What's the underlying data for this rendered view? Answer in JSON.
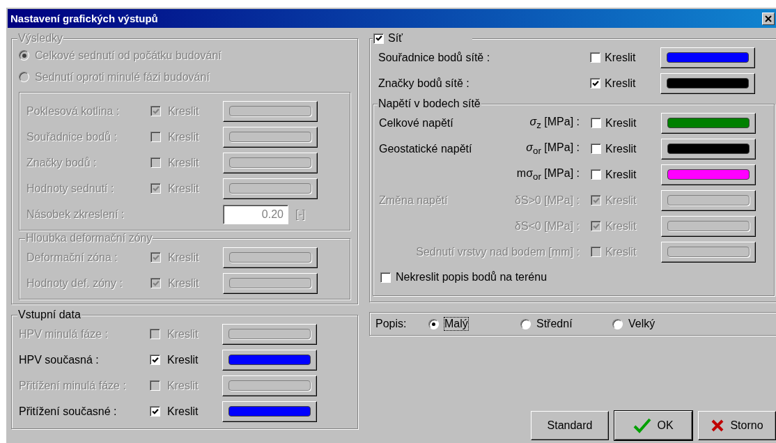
{
  "window": {
    "title": "Nastavení grafických výstupů"
  },
  "results": {
    "title": "Výsledky",
    "disabled": true,
    "radios": [
      {
        "label": "Celkové sednutí od počátku budování",
        "selected": true
      },
      {
        "label": "Sednutí oproti minulé fázi budování",
        "selected": false
      }
    ],
    "rows": [
      {
        "label": "Poklesová kotlina :",
        "checked": true,
        "draw": "Kreslit"
      },
      {
        "label": "Souřadnice bodů :",
        "checked": false,
        "draw": "Kreslit"
      },
      {
        "label": "Značky bodů :",
        "checked": false,
        "draw": "Kreslit"
      },
      {
        "label": "Hodnoty sednutí :",
        "checked": true,
        "draw": "Kreslit"
      }
    ],
    "multiplier": {
      "label": "Násobek zkreslení :",
      "value": "0.20",
      "unit": "[-]"
    },
    "depth": {
      "title": "Hloubka deformační zóny",
      "rows": [
        {
          "label": "Deformační zóna :",
          "checked": true,
          "draw": "Kreslit"
        },
        {
          "label": "Hodnoty def. zóny :",
          "checked": true,
          "draw": "Kreslit"
        }
      ]
    }
  },
  "input_data": {
    "title": "Vstupní data",
    "rows": [
      {
        "label": "HPV minulá fáze :",
        "disabled": true,
        "checked": false,
        "draw": "Kreslit"
      },
      {
        "label": "HPV současná :",
        "disabled": false,
        "checked": true,
        "draw": "Kreslit",
        "color": "#0000ff"
      },
      {
        "label": "Přitížení minulá fáze :",
        "disabled": true,
        "checked": false,
        "draw": "Kreslit"
      },
      {
        "label": "Přitížení současné :",
        "disabled": false,
        "checked": true,
        "draw": "Kreslit",
        "color": "#0000ff"
      }
    ]
  },
  "grid": {
    "title": "Síť",
    "checked": true,
    "rows": [
      {
        "label": "Souřadnice bodů sítě :",
        "checked": false,
        "draw": "Kreslit",
        "color": "#0000ff"
      },
      {
        "label": "Značky bodů sítě :",
        "checked": true,
        "draw": "Kreslit",
        "color": "#000000"
      }
    ],
    "stress": {
      "title": "Napětí v bodech sítě",
      "rows": [
        {
          "label": "Celkové napětí",
          "quantity": "*σ*$_{z}$ [MPa] :",
          "disabled": false,
          "checked": false,
          "draw": "Kreslit",
          "color": "#008000"
        },
        {
          "label": "Geostatické napětí",
          "quantity": "*σ*$_{or}$ [MPa] :",
          "disabled": false,
          "checked": false,
          "draw": "Kreslit",
          "color": "#000000"
        },
        {
          "quantity": "mσ$_{or}$ [MPa] :",
          "disabled": false,
          "checked": false,
          "draw": "Kreslit",
          "color": "#ff00ff"
        },
        {
          "label": "Změna napětí",
          "quantity": "δS>0 [MPa] :",
          "disabled": true,
          "checked": true,
          "draw": "Kreslit"
        },
        {
          "quantity": "δS<0 [MPa] :",
          "disabled": true,
          "checked": true,
          "draw": "Kreslit"
        },
        {
          "quantity": "Sednutí vrstvy nad bodem [mm] :",
          "disabled": true,
          "checked": false,
          "draw": "Kreslit"
        }
      ],
      "hide_labels": {
        "label": "Nekreslit popis bodů na terénu",
        "checked": false
      }
    }
  },
  "label_size": {
    "label": "Popis:",
    "options": [
      {
        "label": "Malý",
        "selected": true,
        "focused": true
      },
      {
        "label": "Střední",
        "selected": false,
        "focused": false
      },
      {
        "label": "Velký",
        "selected": false,
        "focused": false
      }
    ]
  },
  "buttons": [
    {
      "label": "Standard",
      "kind": "standard"
    },
    {
      "label": "OK",
      "kind": "ok"
    },
    {
      "label": "Storno",
      "kind": "cancel"
    }
  ]
}
